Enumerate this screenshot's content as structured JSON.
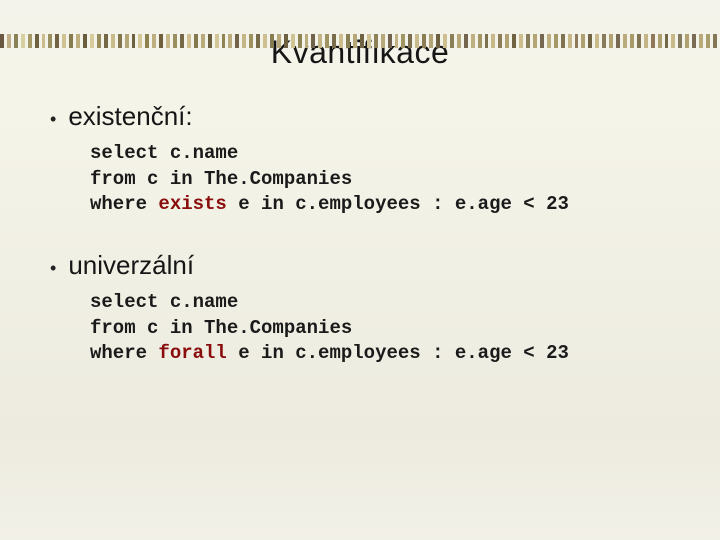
{
  "title": "Kvantifikace",
  "stripe_colors": [
    "#6b5843",
    "#bfae86",
    "#8a8156",
    "#d8cfa0",
    "#a69968",
    "#6f6242",
    "#cdbd8e",
    "#9b905f",
    "#716343",
    "#d0c392",
    "#867b4f",
    "#bcae7f",
    "#6a5d3e",
    "#d7cb9d",
    "#988c5c",
    "#746847",
    "#c9bb8a",
    "#81764c",
    "#b4a677",
    "#6e6141",
    "#d5c898",
    "#8d824f",
    "#bdaf80",
    "#705f3d",
    "#c6b889",
    "#9a8f5e",
    "#766948",
    "#cfbf91",
    "#847a50",
    "#b8aa7b",
    "#6c5f3f",
    "#d3c696",
    "#908552",
    "#bbad7e",
    "#73634a",
    "#c4b687",
    "#9c915f",
    "#786b4a",
    "#cdbf8f",
    "#867c51",
    "#b6a879",
    "#6e6141",
    "#d1c494",
    "#8e8454",
    "#b9ab7c",
    "#71634b",
    "#c2b485",
    "#9e9361",
    "#7a6d4c",
    "#cbbd8d",
    "#888053",
    "#b4a677",
    "#706343",
    "#cfc292",
    "#8c8256",
    "#b7a97a",
    "#72644c",
    "#c0b283",
    "#a09563",
    "#7c6f4e",
    "#c9bb8b",
    "#8a7e55",
    "#b2a475",
    "#6e6141",
    "#cdbf8f",
    "#8a8058",
    "#b5a778",
    "#74664e",
    "#beb081",
    "#a29765",
    "#7e7150",
    "#c7b989",
    "#8c7c57",
    "#b0a273",
    "#706343",
    "#cbbd8d",
    "#887e5a",
    "#b3a576",
    "#766850",
    "#bcae7f",
    "#a49967",
    "#807352",
    "#c5b787",
    "#8e7a59",
    "#aea071",
    "#726545",
    "#c9bb8b",
    "#867c5c",
    "#b1a374",
    "#786a52",
    "#baac7d",
    "#a69b69",
    "#827554",
    "#c3b585",
    "#90785b",
    "#ac9e6f",
    "#746747",
    "#c7b989",
    "#847a5e",
    "#afa172",
    "#7a6c54",
    "#b8aa7b",
    "#a89d6b",
    "#847756"
  ],
  "sections": [
    {
      "label": "existenční:",
      "code": {
        "l1": "select c.name",
        "l2": "from c in The.Companies",
        "l3a": "where ",
        "l3kw": "exists",
        "l3b": " e in c.employees : e.age < 23"
      }
    },
    {
      "label": "univerzální",
      "code": {
        "l1": "select c.name",
        "l2": "from c in The.Companies",
        "l3a": "where ",
        "l3kw": "forall",
        "l3b": " e in c.employees : e.age < 23"
      }
    }
  ]
}
